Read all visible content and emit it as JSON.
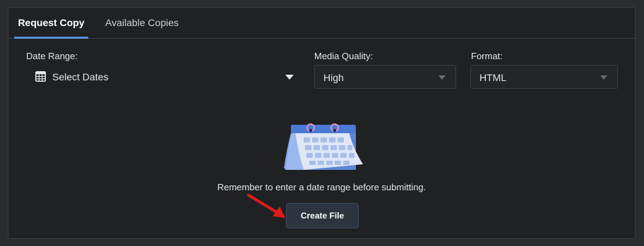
{
  "tabs": [
    {
      "label": "Request Copy",
      "active": true
    },
    {
      "label": "Available Copies",
      "active": false
    }
  ],
  "form": {
    "date_range": {
      "label": "Date Range:",
      "value": "Select Dates",
      "icon": "calendar-grid-icon"
    },
    "media_quality": {
      "label": "Media Quality:",
      "value": "High"
    },
    "format": {
      "label": "Format:",
      "value": "HTML"
    }
  },
  "empty_state": {
    "illustration": "calendar-illustration",
    "message": "Remember to enter a date range before submitting."
  },
  "actions": {
    "create_label": "Create File"
  },
  "colors": {
    "background": "#2b2c2f",
    "panel": "#1f2123",
    "active_tab_underline": "#5d8fd9",
    "button_bg": "#2d3440",
    "annotation_arrow": "#e01b1b"
  }
}
